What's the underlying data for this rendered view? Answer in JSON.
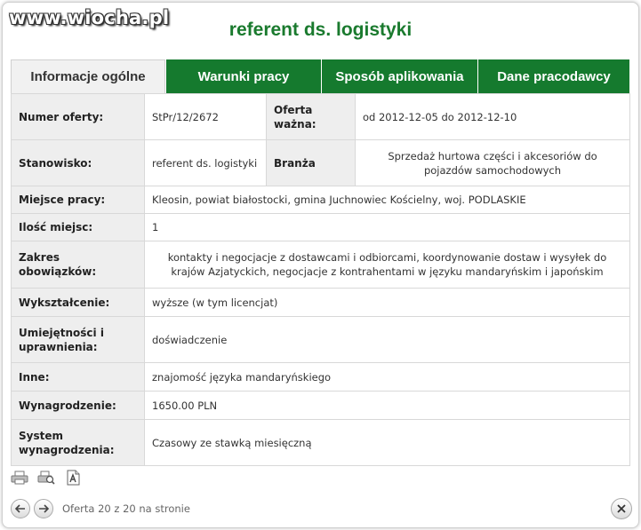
{
  "watermark": "www.wiocha.pl",
  "page_title": "referent ds. logistyki",
  "tabs": [
    {
      "label": "Informacje ogólne",
      "active": true
    },
    {
      "label": "Warunki pracy",
      "active": false
    },
    {
      "label": "Sposób aplikowania",
      "active": false
    },
    {
      "label": "Dane pracodawcy",
      "active": false
    }
  ],
  "details": {
    "offer_number": {
      "label": "Numer oferty:",
      "value": "StPr/12/2672"
    },
    "offer_valid": {
      "label": "Oferta ważna:",
      "value": "od 2012-12-05 do 2012-12-10"
    },
    "position": {
      "label": "Stanowisko:",
      "value": "referent ds. logistyki"
    },
    "industry": {
      "label": "Branża",
      "value": "Sprzedaż hurtowa części i akcesoriów do pojazdów samochodowych"
    },
    "location": {
      "label": "Miejsce pracy:",
      "value": "Kleosin, powiat białostocki, gmina Juchnowiec Kościelny, woj. PODLASKIE"
    },
    "vacancies": {
      "label": "Ilość miejsc:",
      "value": "1"
    },
    "duties": {
      "label": "Zakres obowiązków:",
      "value": "kontakty i negocjacje z dostawcami i odbiorcami, koordynowanie dostaw i wysyłek do krajów Azjatyckich, negocjacje z kontrahentami w języku mandaryńskim i japońskim"
    },
    "education": {
      "label": "Wykształcenie:",
      "value": "wyższe (w tym licencjat)"
    },
    "skills": {
      "label": "Umiejętności i uprawnienia:",
      "value": "doświadczenie"
    },
    "other": {
      "label": "Inne:",
      "value": "znajomość języka mandaryńskiego"
    },
    "salary": {
      "label": "Wynagrodzenie:",
      "value": "1650.00 PLN"
    },
    "pay_system": {
      "label": "System wynagrodzenia:",
      "value": "Czasowy ze stawką miesięczną"
    }
  },
  "toolbar": {
    "icons": [
      "printer-icon",
      "print-preview-icon",
      "pdf-icon"
    ]
  },
  "pagination": {
    "text": "Oferta 20 z 20 na stronie"
  },
  "colors": {
    "brand_green": "#157a2e",
    "title_green": "#1a7a2e",
    "label_bg": "#eeeeee"
  }
}
